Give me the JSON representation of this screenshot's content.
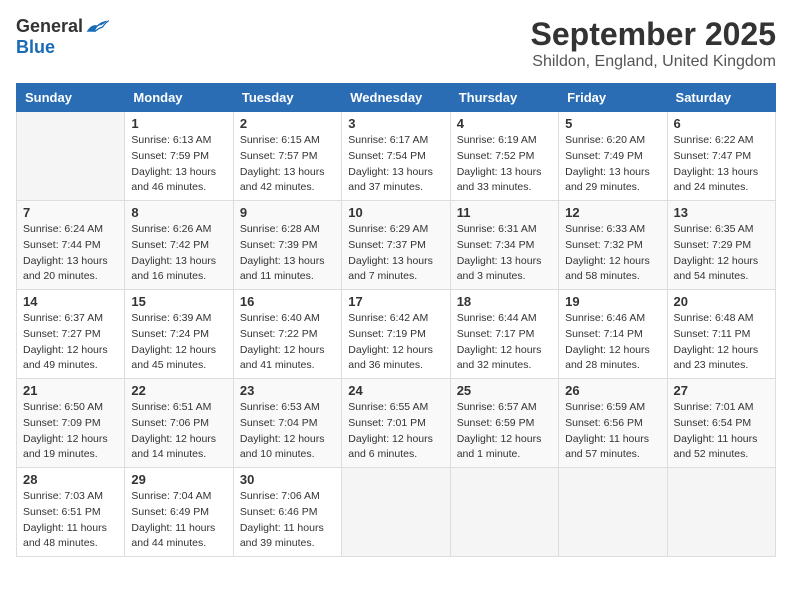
{
  "header": {
    "logo_general": "General",
    "logo_blue": "Blue",
    "month_title": "September 2025",
    "location": "Shildon, England, United Kingdom"
  },
  "weekdays": [
    "Sunday",
    "Monday",
    "Tuesday",
    "Wednesday",
    "Thursday",
    "Friday",
    "Saturday"
  ],
  "weeks": [
    [
      {
        "day": "",
        "info": ""
      },
      {
        "day": "1",
        "info": "Sunrise: 6:13 AM\nSunset: 7:59 PM\nDaylight: 13 hours\nand 46 minutes."
      },
      {
        "day": "2",
        "info": "Sunrise: 6:15 AM\nSunset: 7:57 PM\nDaylight: 13 hours\nand 42 minutes."
      },
      {
        "day": "3",
        "info": "Sunrise: 6:17 AM\nSunset: 7:54 PM\nDaylight: 13 hours\nand 37 minutes."
      },
      {
        "day": "4",
        "info": "Sunrise: 6:19 AM\nSunset: 7:52 PM\nDaylight: 13 hours\nand 33 minutes."
      },
      {
        "day": "5",
        "info": "Sunrise: 6:20 AM\nSunset: 7:49 PM\nDaylight: 13 hours\nand 29 minutes."
      },
      {
        "day": "6",
        "info": "Sunrise: 6:22 AM\nSunset: 7:47 PM\nDaylight: 13 hours\nand 24 minutes."
      }
    ],
    [
      {
        "day": "7",
        "info": "Sunrise: 6:24 AM\nSunset: 7:44 PM\nDaylight: 13 hours\nand 20 minutes."
      },
      {
        "day": "8",
        "info": "Sunrise: 6:26 AM\nSunset: 7:42 PM\nDaylight: 13 hours\nand 16 minutes."
      },
      {
        "day": "9",
        "info": "Sunrise: 6:28 AM\nSunset: 7:39 PM\nDaylight: 13 hours\nand 11 minutes."
      },
      {
        "day": "10",
        "info": "Sunrise: 6:29 AM\nSunset: 7:37 PM\nDaylight: 13 hours\nand 7 minutes."
      },
      {
        "day": "11",
        "info": "Sunrise: 6:31 AM\nSunset: 7:34 PM\nDaylight: 13 hours\nand 3 minutes."
      },
      {
        "day": "12",
        "info": "Sunrise: 6:33 AM\nSunset: 7:32 PM\nDaylight: 12 hours\nand 58 minutes."
      },
      {
        "day": "13",
        "info": "Sunrise: 6:35 AM\nSunset: 7:29 PM\nDaylight: 12 hours\nand 54 minutes."
      }
    ],
    [
      {
        "day": "14",
        "info": "Sunrise: 6:37 AM\nSunset: 7:27 PM\nDaylight: 12 hours\nand 49 minutes."
      },
      {
        "day": "15",
        "info": "Sunrise: 6:39 AM\nSunset: 7:24 PM\nDaylight: 12 hours\nand 45 minutes."
      },
      {
        "day": "16",
        "info": "Sunrise: 6:40 AM\nSunset: 7:22 PM\nDaylight: 12 hours\nand 41 minutes."
      },
      {
        "day": "17",
        "info": "Sunrise: 6:42 AM\nSunset: 7:19 PM\nDaylight: 12 hours\nand 36 minutes."
      },
      {
        "day": "18",
        "info": "Sunrise: 6:44 AM\nSunset: 7:17 PM\nDaylight: 12 hours\nand 32 minutes."
      },
      {
        "day": "19",
        "info": "Sunrise: 6:46 AM\nSunset: 7:14 PM\nDaylight: 12 hours\nand 28 minutes."
      },
      {
        "day": "20",
        "info": "Sunrise: 6:48 AM\nSunset: 7:11 PM\nDaylight: 12 hours\nand 23 minutes."
      }
    ],
    [
      {
        "day": "21",
        "info": "Sunrise: 6:50 AM\nSunset: 7:09 PM\nDaylight: 12 hours\nand 19 minutes."
      },
      {
        "day": "22",
        "info": "Sunrise: 6:51 AM\nSunset: 7:06 PM\nDaylight: 12 hours\nand 14 minutes."
      },
      {
        "day": "23",
        "info": "Sunrise: 6:53 AM\nSunset: 7:04 PM\nDaylight: 12 hours\nand 10 minutes."
      },
      {
        "day": "24",
        "info": "Sunrise: 6:55 AM\nSunset: 7:01 PM\nDaylight: 12 hours\nand 6 minutes."
      },
      {
        "day": "25",
        "info": "Sunrise: 6:57 AM\nSunset: 6:59 PM\nDaylight: 12 hours\nand 1 minute."
      },
      {
        "day": "26",
        "info": "Sunrise: 6:59 AM\nSunset: 6:56 PM\nDaylight: 11 hours\nand 57 minutes."
      },
      {
        "day": "27",
        "info": "Sunrise: 7:01 AM\nSunset: 6:54 PM\nDaylight: 11 hours\nand 52 minutes."
      }
    ],
    [
      {
        "day": "28",
        "info": "Sunrise: 7:03 AM\nSunset: 6:51 PM\nDaylight: 11 hours\nand 48 minutes."
      },
      {
        "day": "29",
        "info": "Sunrise: 7:04 AM\nSunset: 6:49 PM\nDaylight: 11 hours\nand 44 minutes."
      },
      {
        "day": "30",
        "info": "Sunrise: 7:06 AM\nSunset: 6:46 PM\nDaylight: 11 hours\nand 39 minutes."
      },
      {
        "day": "",
        "info": ""
      },
      {
        "day": "",
        "info": ""
      },
      {
        "day": "",
        "info": ""
      },
      {
        "day": "",
        "info": ""
      }
    ]
  ]
}
